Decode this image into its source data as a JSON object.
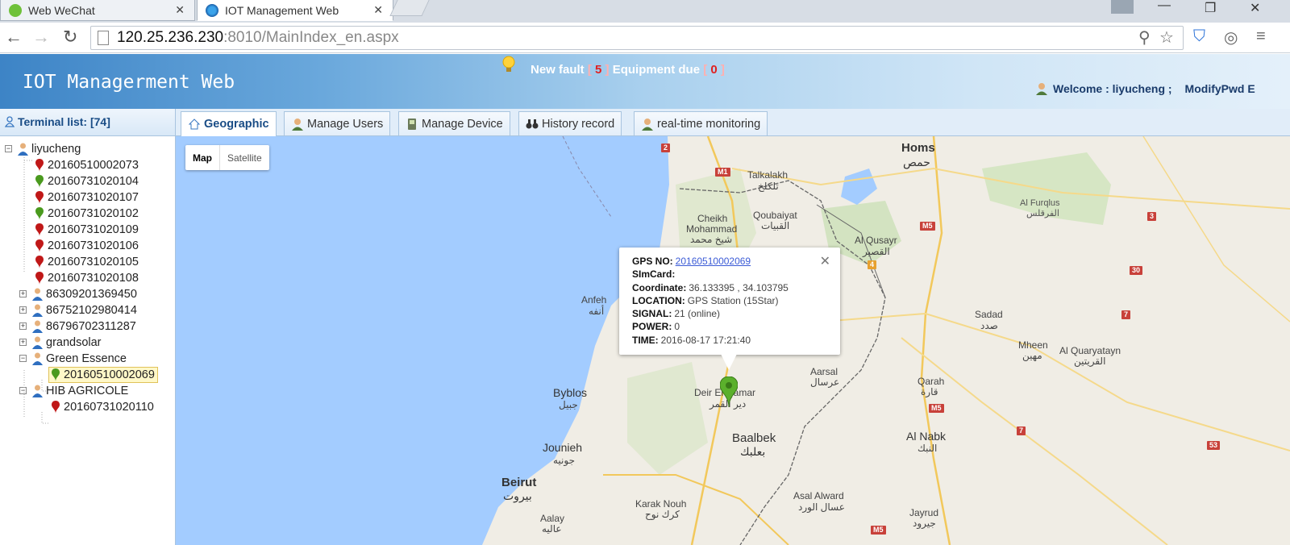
{
  "browser": {
    "tabs": [
      {
        "title": "Web WeChat",
        "active": false,
        "icon": "wechat-icon"
      },
      {
        "title": "IOT Management Web",
        "active": true,
        "icon": "ie-globe-icon"
      }
    ],
    "address": {
      "host": "120.25.236.230",
      "port": ":8010",
      "path": "/MainIndex_en.aspx"
    }
  },
  "header": {
    "title": "IOT Managerment Web",
    "new_fault_label": "New fault",
    "new_fault_count": "5",
    "equipment_due_label": "Equipment due",
    "equipment_due_count": "0",
    "welcome": "Welcome : liyucheng ;",
    "modify_pwd": "ModifyPwd E"
  },
  "sidebar": {
    "title": "Terminal list: [74]",
    "tree": [
      {
        "label": "liyucheng",
        "type": "user",
        "expanded": true
      },
      {
        "label": "20160510002073",
        "type": "device",
        "status": "red"
      },
      {
        "label": "20160731020104",
        "type": "device",
        "status": "green"
      },
      {
        "label": "20160731020107",
        "type": "device",
        "status": "red"
      },
      {
        "label": "20160731020102",
        "type": "device",
        "status": "green"
      },
      {
        "label": "20160731020109",
        "type": "device",
        "status": "red"
      },
      {
        "label": "20160731020106",
        "type": "device",
        "status": "red"
      },
      {
        "label": "20160731020105",
        "type": "device",
        "status": "red"
      },
      {
        "label": "20160731020108",
        "type": "device",
        "status": "red"
      },
      {
        "label": "86309201369450",
        "type": "user",
        "expanded": false
      },
      {
        "label": "86752102980414",
        "type": "user",
        "expanded": false
      },
      {
        "label": "86796702311287",
        "type": "user",
        "expanded": false
      },
      {
        "label": "grandsolar",
        "type": "user",
        "expanded": false
      },
      {
        "label": "Green Essence",
        "type": "user",
        "expanded": true
      },
      {
        "label": "20160510002069",
        "type": "device",
        "status": "green",
        "selected": true
      },
      {
        "label": "HIB AGRICOLE",
        "type": "user",
        "expanded": true
      },
      {
        "label": "20160731020110",
        "type": "device",
        "status": "red"
      }
    ]
  },
  "tabs": [
    {
      "label": "Geographic",
      "icon": "house-icon",
      "active": true
    },
    {
      "label": "Manage Users",
      "icon": "user-icon",
      "active": false
    },
    {
      "label": "Manage Device",
      "icon": "device-icon",
      "active": false
    },
    {
      "label": "History record",
      "icon": "binoculars-icon",
      "active": false
    },
    {
      "label": "real-time monitoring",
      "icon": "user-icon",
      "active": false
    }
  ],
  "map": {
    "map_type": [
      "Map",
      "Satellite"
    ],
    "labels": {
      "homs": "Homs",
      "homs_ar": "حمص",
      "talkalakh": "Talkalakh",
      "talkalakh_ar": "تلكلخ",
      "cheikh": "Cheikh",
      "mohammad": "Mohammad",
      "cheikh_ar": "شيخ محمد",
      "qoubaiyat": "Qoubaiyat",
      "qoubaiyat_ar": "القبيات",
      "alqusayr": "Al Qusayr",
      "alqusayr_ar": "القصير",
      "alfurqlus": "Al Furqlus",
      "alfurqlus_ar": "الفرقلس",
      "anfeh": "Anfeh",
      "anfeh_ar": "أنفه",
      "sadad": "Sadad",
      "sadad_ar": "صدد",
      "mheen": "Mheen",
      "mheen_ar": "مهين",
      "alquaryatayn": "Al Quaryatayn",
      "alquaryatayn_ar": "القريتين",
      "aarsal": "Aarsal",
      "aarsal_ar": "عرسال",
      "qarah": "Qarah",
      "qarah_ar": "قارة",
      "byblos": "Byblos",
      "byblos_ar": "جبيل",
      "deirelqamar": "Deir El Qamar",
      "deirelqamar_ar": "دير القمر",
      "jounieh": "Jounieh",
      "jounieh_ar": "جونيه",
      "baalbek": "Baalbek",
      "baalbek_ar": "بعلبك",
      "alnabk": "Al Nabk",
      "alnabk_ar": "النبك",
      "beirut": "Beirut",
      "beirut_ar": "بيروت",
      "karaknouh": "Karak Nouh",
      "karaknouh_ar": "كرك نوح",
      "asalalward": "Asal Alward",
      "asalalward_ar": "عسال الورد",
      "aalay": "Aalay",
      "aalay_ar": "عاليه",
      "jayrud": "Jayrud",
      "jayrud_ar": "جيرود"
    },
    "shields": [
      "2",
      "M1",
      "M5",
      "3",
      "30",
      "7",
      "4",
      "M5",
      "7",
      "53",
      "M5"
    ],
    "info": {
      "gps_no_label": "GPS NO:",
      "gps_no": "20160510002069",
      "sim_label": "SImCard:",
      "sim": "",
      "coord_label": "Coordinate:",
      "coord": "36.133395 , 34.103795",
      "location_label": "LOCATION:",
      "location": "GPS Station (15Star)",
      "signal_label": "SIGNAL:",
      "signal": "21 (online)",
      "power_label": "POWER:",
      "power": "0",
      "time_label": "TIME:",
      "time": "2016-08-17 17:21:40"
    }
  },
  "colors": {
    "sea": "#a3ccff",
    "land": "#f0ede5",
    "accent": "#1a4d86",
    "marker": "#5bb02c",
    "fault": "#e02020"
  }
}
